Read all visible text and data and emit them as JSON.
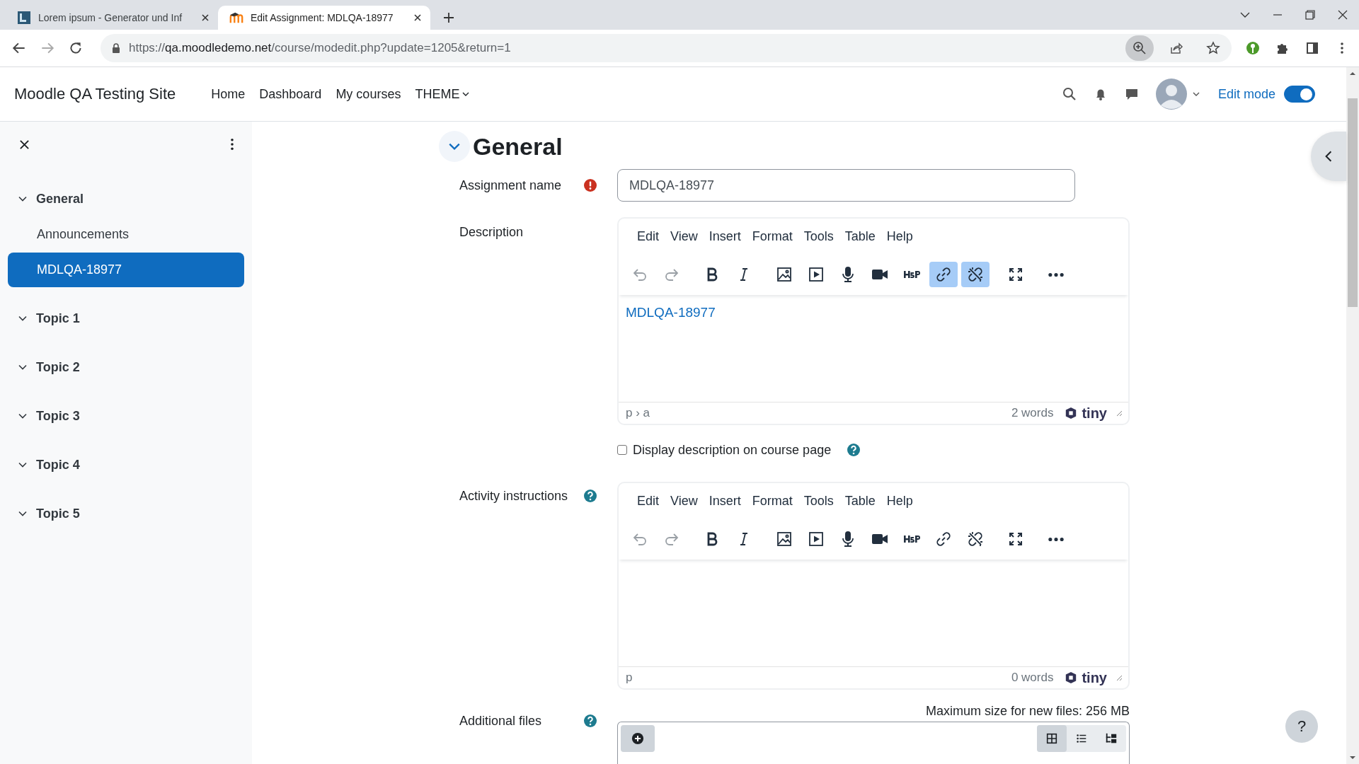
{
  "browser": {
    "tabs": [
      {
        "title": "Lorem ipsum - Generator und Inf",
        "kind": "letter",
        "selected": false
      },
      {
        "title": "Edit Assignment: MDLQA-18977",
        "kind": "moodle",
        "selected": true
      }
    ],
    "url": {
      "scheme": "https://",
      "host": "qa.moodledemo.net",
      "path": "/course/modedit.php?update=1205&return=1"
    },
    "zoom_active": true
  },
  "site": {
    "name": "Moodle QA Testing Site",
    "nav": [
      {
        "label": "Home",
        "kind": "link"
      },
      {
        "label": "Dashboard",
        "kind": "link"
      },
      {
        "label": "My courses",
        "kind": "link"
      },
      {
        "label": "THEME",
        "kind": "menu"
      }
    ],
    "edit_mode": {
      "label": "Edit mode",
      "on": true
    }
  },
  "sidebar": {
    "sections": [
      {
        "title": "General",
        "expanded": true,
        "children": [
          {
            "label": "Announcements",
            "selected": false
          },
          {
            "label": "MDLQA-18977",
            "selected": true
          }
        ]
      },
      {
        "title": "Topic 1",
        "expanded": true
      },
      {
        "title": "Topic 2",
        "expanded": true
      },
      {
        "title": "Topic 3",
        "expanded": true
      },
      {
        "title": "Topic 4",
        "expanded": true
      },
      {
        "title": "Topic 5",
        "expanded": true
      }
    ]
  },
  "section": {
    "title": "General",
    "expanded": true
  },
  "assignment_name": {
    "label": "Assignment name",
    "required": true,
    "value": "MDLQA-18977"
  },
  "description": {
    "label": "Description",
    "editor": {
      "menu": [
        "Edit",
        "View",
        "Insert",
        "Format",
        "Tools",
        "Table",
        "Help"
      ],
      "toolbar": [
        {
          "kind": "undo",
          "active": false,
          "disabled": true
        },
        {
          "kind": "redo",
          "active": false,
          "disabled": true
        },
        {
          "kind": "bold",
          "active": false,
          "disabled": false
        },
        {
          "kind": "italic",
          "active": false,
          "disabled": false
        },
        {
          "kind": "image",
          "active": false,
          "disabled": false
        },
        {
          "kind": "media",
          "active": false,
          "disabled": false
        },
        {
          "kind": "mic",
          "active": false,
          "disabled": false
        },
        {
          "kind": "video",
          "active": false,
          "disabled": false
        },
        {
          "kind": "h5p",
          "active": false,
          "disabled": false
        },
        {
          "kind": "link",
          "active": true,
          "disabled": false
        },
        {
          "kind": "unlink",
          "active": true,
          "disabled": false
        },
        {
          "kind": "fullscreen",
          "active": false,
          "disabled": false
        },
        {
          "kind": "more",
          "active": false,
          "disabled": false
        }
      ],
      "content_link": "MDLQA-18977",
      "path": "p › a",
      "word_count": "2 words",
      "brand": "tiny"
    }
  },
  "display_description": {
    "label": "Display description on course page",
    "checked": false
  },
  "activity_instructions": {
    "label": "Activity instructions",
    "help": true,
    "editor": {
      "menu": [
        "Edit",
        "View",
        "Insert",
        "Format",
        "Tools",
        "Table",
        "Help"
      ],
      "toolbar": [
        {
          "kind": "undo",
          "active": false,
          "disabled": true
        },
        {
          "kind": "redo",
          "active": false,
          "disabled": true
        },
        {
          "kind": "bold",
          "active": false,
          "disabled": false
        },
        {
          "kind": "italic",
          "active": false,
          "disabled": false
        },
        {
          "kind": "image",
          "active": false,
          "disabled": false
        },
        {
          "kind": "media",
          "active": false,
          "disabled": false
        },
        {
          "kind": "mic",
          "active": false,
          "disabled": false
        },
        {
          "kind": "video",
          "active": false,
          "disabled": false
        },
        {
          "kind": "h5p",
          "active": false,
          "disabled": false
        },
        {
          "kind": "link",
          "active": false,
          "disabled": false
        },
        {
          "kind": "unlink",
          "active": false,
          "disabled": false
        },
        {
          "kind": "fullscreen",
          "active": false,
          "disabled": false
        },
        {
          "kind": "more",
          "active": false,
          "disabled": false
        }
      ],
      "path": "p",
      "word_count": "0 words",
      "brand": "tiny"
    }
  },
  "additional_files": {
    "label": "Additional files",
    "help": true,
    "max_size": "Maximum size for new files: 256 MB",
    "view_modes": [
      {
        "kind": "grid",
        "selected": true
      },
      {
        "kind": "list",
        "selected": false
      },
      {
        "kind": "tree",
        "selected": false
      }
    ]
  },
  "help_button": "?"
}
